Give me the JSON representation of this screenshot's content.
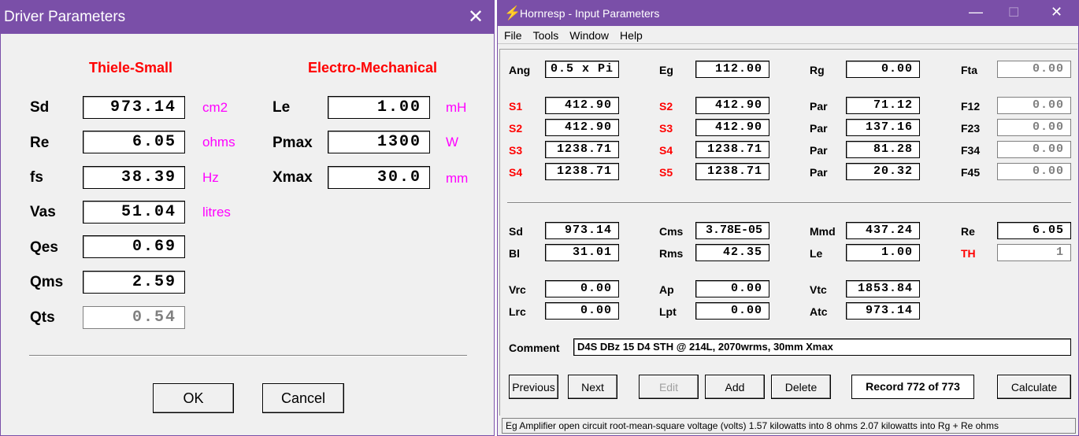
{
  "driver": {
    "title": "Driver Parameters",
    "ts_heading": "Thiele-Small",
    "em_heading": "Electro-Mechanical",
    "ts": [
      {
        "label": "Sd",
        "value": "973.14",
        "unit": "cm2"
      },
      {
        "label": "Re",
        "value": "6.05",
        "unit": "ohms"
      },
      {
        "label": "fs",
        "value": "38.39",
        "unit": "Hz"
      },
      {
        "label": "Vas",
        "value": "51.04",
        "unit": "litres"
      },
      {
        "label": "Qes",
        "value": "0.69",
        "unit": ""
      },
      {
        "label": "Qms",
        "value": "2.59",
        "unit": ""
      },
      {
        "label": "Qts",
        "value": "0.54",
        "unit": ""
      }
    ],
    "em": [
      {
        "label": "Le",
        "value": "1.00",
        "unit": "mH"
      },
      {
        "label": "Pmax",
        "value": "1300",
        "unit": "W"
      },
      {
        "label": "Xmax",
        "value": "30.0",
        "unit": "mm"
      }
    ],
    "ok_label": "OK",
    "cancel_label": "Cancel"
  },
  "hornresp": {
    "title": "Hornresp - Input Parameters",
    "menu": {
      "file": "File",
      "tools": "Tools",
      "window": "Window",
      "help": "Help"
    },
    "top": [
      {
        "label": "Ang",
        "value": "0.5 x Pi"
      },
      {
        "label": "Eg",
        "value": "112.00"
      },
      {
        "label": "Rg",
        "value": "0.00"
      },
      {
        "label": "Fta",
        "value": "0.00"
      }
    ],
    "segments": [
      [
        "S1",
        "412.90",
        "S2",
        "412.90",
        "Par",
        "71.12",
        "F12",
        "0.00"
      ],
      [
        "S2",
        "412.90",
        "S3",
        "412.90",
        "Par",
        "137.16",
        "F23",
        "0.00"
      ],
      [
        "S3",
        "1238.71",
        "S4",
        "1238.71",
        "Par",
        "81.28",
        "F34",
        "0.00"
      ],
      [
        "S4",
        "1238.71",
        "S5",
        "1238.71",
        "Par",
        "20.32",
        "F45",
        "0.00"
      ]
    ],
    "drv1": [
      {
        "label": "Sd",
        "value": "973.14"
      },
      {
        "label": "Cms",
        "value": "3.78E-05"
      },
      {
        "label": "Mmd",
        "value": "437.24"
      },
      {
        "label": "Re",
        "value": "6.05"
      }
    ],
    "drv2": [
      {
        "label": "Bl",
        "value": "31.01"
      },
      {
        "label": "Rms",
        "value": "42.35"
      },
      {
        "label": "Le",
        "value": "1.00"
      },
      {
        "label": "TH",
        "value": "1"
      }
    ],
    "ch1": [
      {
        "label": "Vrc",
        "value": "0.00"
      },
      {
        "label": "Ap",
        "value": "0.00"
      },
      {
        "label": "Vtc",
        "value": "1853.84"
      }
    ],
    "ch2": [
      {
        "label": "Lrc",
        "value": "0.00"
      },
      {
        "label": "Lpt",
        "value": "0.00"
      },
      {
        "label": "Atc",
        "value": "973.14"
      }
    ],
    "comment_label": "Comment",
    "comment": "D4S DBz 15 D4 STH @ 214L, 2070wrms, 30mm Xmax",
    "buttons": {
      "previous": "Previous",
      "next": "Next",
      "edit": "Edit",
      "add": "Add",
      "delete": "Delete",
      "record": "Record 772 of 773",
      "calculate": "Calculate"
    },
    "status": "Eg  Amplifier open circuit root-mean-square voltage  (volts)   1.57 kilowatts into 8 ohms   2.07 kilowatts into Rg + Re ohms"
  }
}
